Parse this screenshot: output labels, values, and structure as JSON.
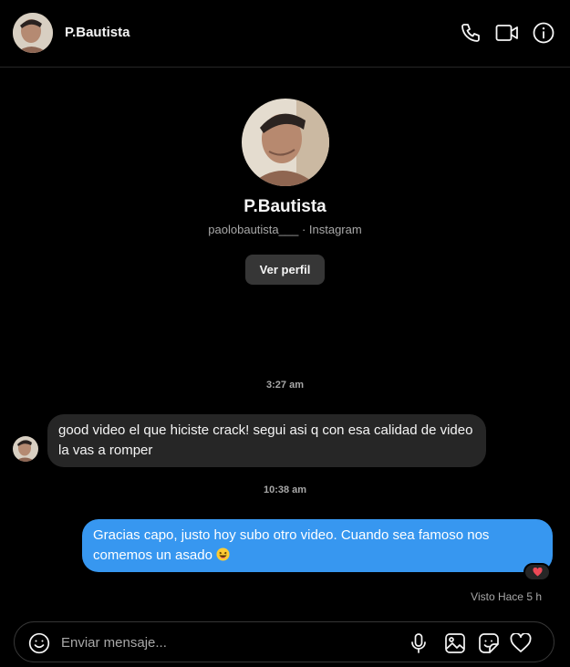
{
  "header": {
    "name": "P.Bautista",
    "icons": [
      "phone-icon",
      "video-icon",
      "info-icon"
    ]
  },
  "profile": {
    "name": "P.Bautista",
    "subtitle": "paolobautista___ · Instagram",
    "view_profile_label": "Ver perfil"
  },
  "messages": [
    {
      "timestamp": "3:27 am",
      "direction": "incoming",
      "text": "good video el que hiciste crack! segui asi q con esa calidad de video la vas a romper"
    },
    {
      "timestamp": "10:38 am",
      "direction": "outgoing",
      "text": "Gracias capo, justo hoy subo otro video. Cuando sea famoso nos comemos un asado",
      "emoji": "laughing-face",
      "reaction": "❤️"
    }
  ],
  "seen_status": "Visto Hace 5 h",
  "composer": {
    "placeholder": "Enviar mensaje...",
    "icons": [
      "emoji-icon",
      "microphone-icon",
      "image-icon",
      "sticker-icon",
      "heart-icon"
    ]
  },
  "colors": {
    "background": "#000000",
    "incoming_bubble": "#262626",
    "outgoing_bubble": "#3797f0",
    "secondary_text": "#a8a8a8"
  }
}
